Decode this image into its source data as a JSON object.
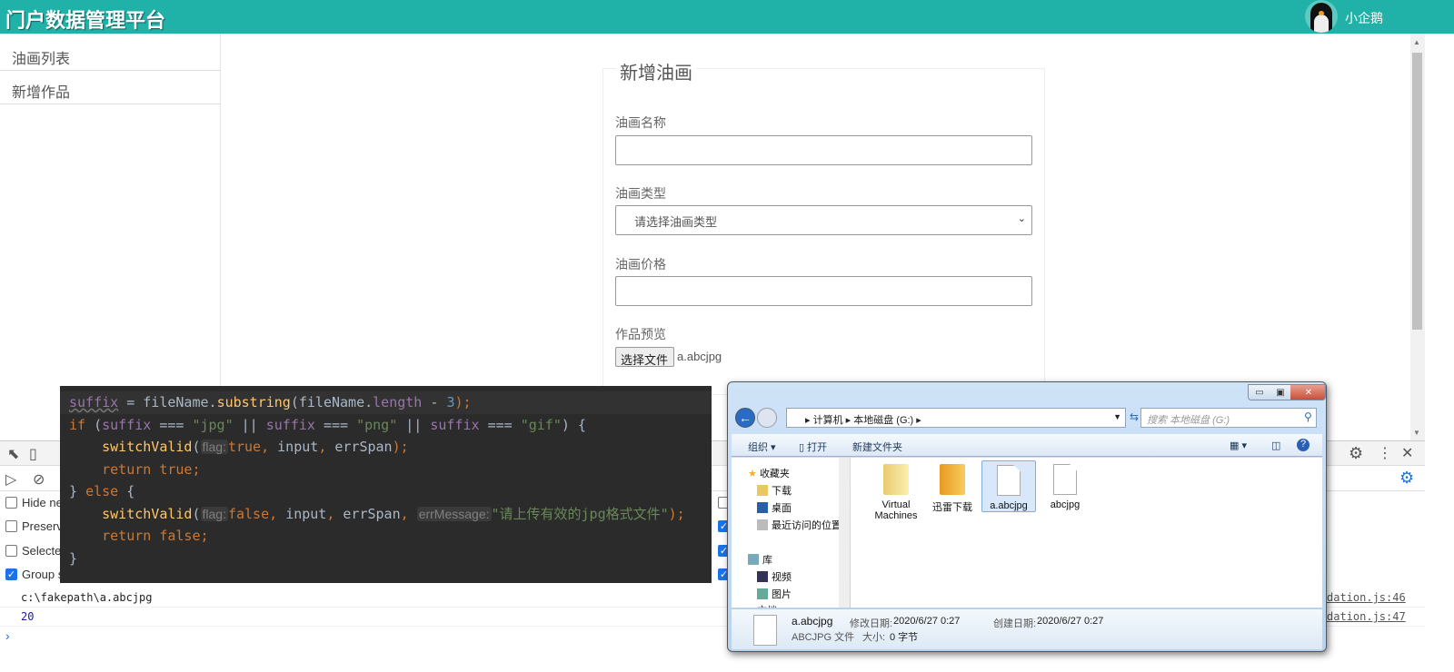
{
  "header": {
    "title": "门户数据管理平台",
    "username": "小企鹅",
    "accent": "#20b2a8"
  },
  "sidebar": {
    "items": [
      {
        "label": "油画列表"
      },
      {
        "label": "新增作品"
      }
    ]
  },
  "form": {
    "legend": "新增油画",
    "name_label": "油画名称",
    "name_value": "",
    "type_label": "油画类型",
    "type_placeholder": "请选择油画类型",
    "price_label": "油画价格",
    "price_value": "",
    "preview_label": "作品预览",
    "file_button": "选择文件",
    "file_name": "a.abcjpg"
  },
  "devtools": {
    "checkboxes": [
      {
        "label": "Hide ne",
        "checked": false
      },
      {
        "label": "Preserve",
        "checked": false
      },
      {
        "label": "Selected",
        "checked": false
      },
      {
        "label": "Group s",
        "checked": true
      }
    ],
    "right_checkboxes": [
      false,
      true,
      true,
      true
    ],
    "console": [
      {
        "text": "c:\\fakepath\\a.abcjpg",
        "source": "dation.js:46",
        "color": "#222"
      },
      {
        "text": "20",
        "source": "dation.js:47",
        "color": "#1a1aa6"
      }
    ],
    "prompt": "›"
  },
  "code": {
    "lines": [
      [
        {
          "t": "suffix",
          "c": "var under"
        },
        {
          "t": " = fileName.",
          "c": "def"
        },
        {
          "t": "substring",
          "c": "fn"
        },
        {
          "t": "(fileName.",
          "c": "def"
        },
        {
          "t": "length",
          "c": "var"
        },
        {
          "t": " - ",
          "c": "def"
        },
        {
          "t": "3",
          "c": "num"
        },
        {
          "t": ");",
          "c": "kw"
        }
      ],
      [
        {
          "t": "if",
          "c": "kw"
        },
        {
          "t": " (",
          "c": "def"
        },
        {
          "t": "suffix",
          "c": "var"
        },
        {
          "t": " === ",
          "c": "def"
        },
        {
          "t": "\"jpg\"",
          "c": "str"
        },
        {
          "t": " || ",
          "c": "def"
        },
        {
          "t": "suffix",
          "c": "var"
        },
        {
          "t": " === ",
          "c": "def"
        },
        {
          "t": "\"png\"",
          "c": "str"
        },
        {
          "t": " || ",
          "c": "def"
        },
        {
          "t": "suffix",
          "c": "var"
        },
        {
          "t": " === ",
          "c": "def"
        },
        {
          "t": "\"gif\"",
          "c": "str"
        },
        {
          "t": ") {",
          "c": "def"
        }
      ],
      [
        {
          "t": "    ",
          "c": "def"
        },
        {
          "t": "switchValid",
          "c": "fn"
        },
        {
          "t": "(",
          "c": "def"
        },
        {
          "t": "flag:",
          "c": "hint"
        },
        {
          "t": "true",
          "c": "kw"
        },
        {
          "t": ", ",
          "c": "kw"
        },
        {
          "t": "input",
          "c": "def"
        },
        {
          "t": ", ",
          "c": "kw"
        },
        {
          "t": "errSpan",
          "c": "def"
        },
        {
          "t": ");",
          "c": "kw"
        }
      ],
      [
        {
          "t": "    ",
          "c": "def"
        },
        {
          "t": "return true;",
          "c": "kw"
        }
      ],
      [
        {
          "t": "} ",
          "c": "def"
        },
        {
          "t": "else",
          "c": "kw"
        },
        {
          "t": " {",
          "c": "def"
        }
      ],
      [
        {
          "t": "    ",
          "c": "def"
        },
        {
          "t": "switchValid",
          "c": "fn"
        },
        {
          "t": "(",
          "c": "def"
        },
        {
          "t": "flag:",
          "c": "hint"
        },
        {
          "t": "false",
          "c": "kw"
        },
        {
          "t": ", ",
          "c": "kw"
        },
        {
          "t": "input",
          "c": "def"
        },
        {
          "t": ", ",
          "c": "kw"
        },
        {
          "t": "errSpan",
          "c": "def"
        },
        {
          "t": ", ",
          "c": "kw"
        },
        {
          "t": "errMessage:",
          "c": "hint"
        },
        {
          "t": "\"请上传有效的jpg格式文件\"",
          "c": "str"
        },
        {
          "t": ");",
          "c": "kw"
        }
      ],
      [
        {
          "t": "    ",
          "c": "def"
        },
        {
          "t": "return false;",
          "c": "kw"
        }
      ],
      [
        {
          "t": "}",
          "c": "def"
        }
      ]
    ]
  },
  "explorer": {
    "address": [
      "计算机",
      "本地磁盘 (G:)"
    ],
    "search_placeholder": "搜索 本地磁盘 (G:)",
    "toolbar": {
      "organize": "组织 ▾",
      "open": "打开",
      "new_folder": "新建文件夹"
    },
    "nav": {
      "favorites": "收藏夹",
      "fav_items": [
        "下载",
        "桌面",
        "最近访问的位置"
      ],
      "libraries": "库",
      "lib_items": [
        "视频",
        "图片",
        "文档"
      ]
    },
    "files": [
      {
        "name": "Virtual Machines",
        "kind": "folder"
      },
      {
        "name": "迅雷下载",
        "kind": "folder-orange"
      },
      {
        "name": "a.abcjpg",
        "kind": "file",
        "selected": true
      },
      {
        "name": "abcjpg",
        "kind": "file"
      }
    ],
    "details": {
      "name": "a.abcjpg",
      "type": "ABCJPG 文件",
      "modified_label": "修改日期:",
      "modified": "2020/6/27 0:27",
      "created_label": "创建日期:",
      "created": "2020/6/27 0:27",
      "size_label": "大小:",
      "size": "0 字节"
    }
  }
}
